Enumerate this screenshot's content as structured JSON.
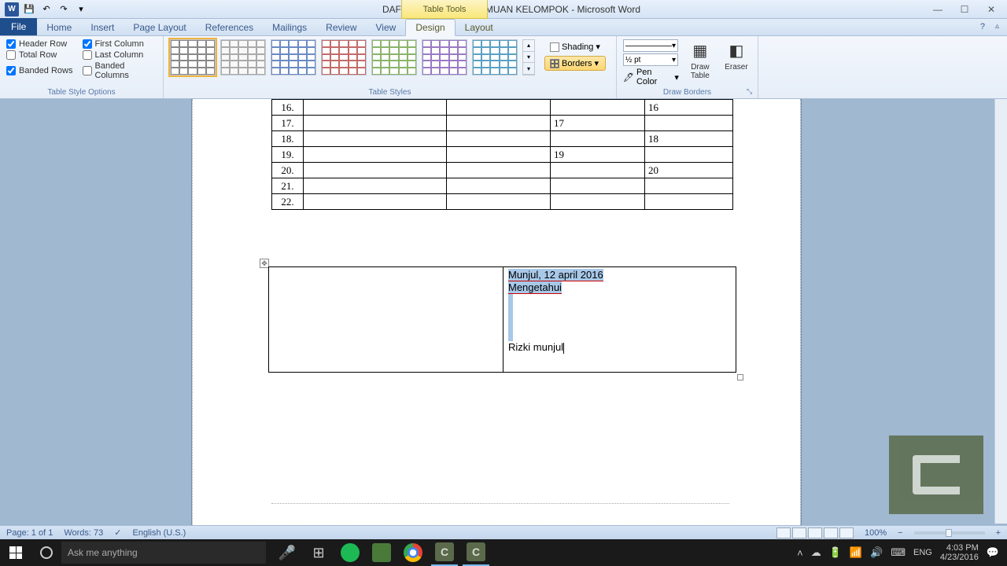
{
  "titlebar": {
    "doc_title": "DAFTAR HADIR PERTEMUAN KELOMPOK - Microsoft Word",
    "table_tools": "Table Tools"
  },
  "tabs": {
    "file": "File",
    "home": "Home",
    "insert": "Insert",
    "page_layout": "Page Layout",
    "references": "References",
    "mailings": "Mailings",
    "review": "Review",
    "view": "View",
    "design": "Design",
    "layout": "Layout"
  },
  "ribbon": {
    "tso": {
      "header_row": "Header Row",
      "total_row": "Total Row",
      "banded_rows": "Banded Rows",
      "first_column": "First Column",
      "last_column": "Last Column",
      "banded_columns": "Banded Columns",
      "group": "Table Style Options"
    },
    "styles_group": "Table Styles",
    "shading": "Shading",
    "borders": "Borders",
    "draw": {
      "weight": "½ pt",
      "pen_color": "Pen Color",
      "draw_table": "Draw\nTable",
      "eraser": "Eraser",
      "group": "Draw Borders"
    }
  },
  "table": {
    "rows": [
      {
        "n": "16.",
        "a": "",
        "b": "",
        "c": "",
        "d": "16"
      },
      {
        "n": "17.",
        "a": "",
        "b": "",
        "c": "17",
        "d": ""
      },
      {
        "n": "18.",
        "a": "",
        "b": "",
        "c": "",
        "d": "18"
      },
      {
        "n": "19.",
        "a": "",
        "b": "",
        "c": "19",
        "d": ""
      },
      {
        "n": "20.",
        "a": "",
        "b": "",
        "c": "",
        "d": "20"
      },
      {
        "n": "21.",
        "a": "",
        "b": "",
        "c": "",
        "d": ""
      },
      {
        "n": "22.",
        "a": "",
        "b": "",
        "c": "",
        "d": ""
      }
    ]
  },
  "signature": {
    "date": "Munjul, 12 april 2016",
    "mengetahui": "Mengetahui",
    "name": "Rizki munjul"
  },
  "status": {
    "page": "Page: 1 of 1",
    "words": "Words: 73",
    "lang": "English (U.S.)",
    "zoom": "100%"
  },
  "taskbar": {
    "search_placeholder": "Ask me anything",
    "lang": "ENG",
    "time": "4:03 PM",
    "date": "4/23/2016"
  }
}
